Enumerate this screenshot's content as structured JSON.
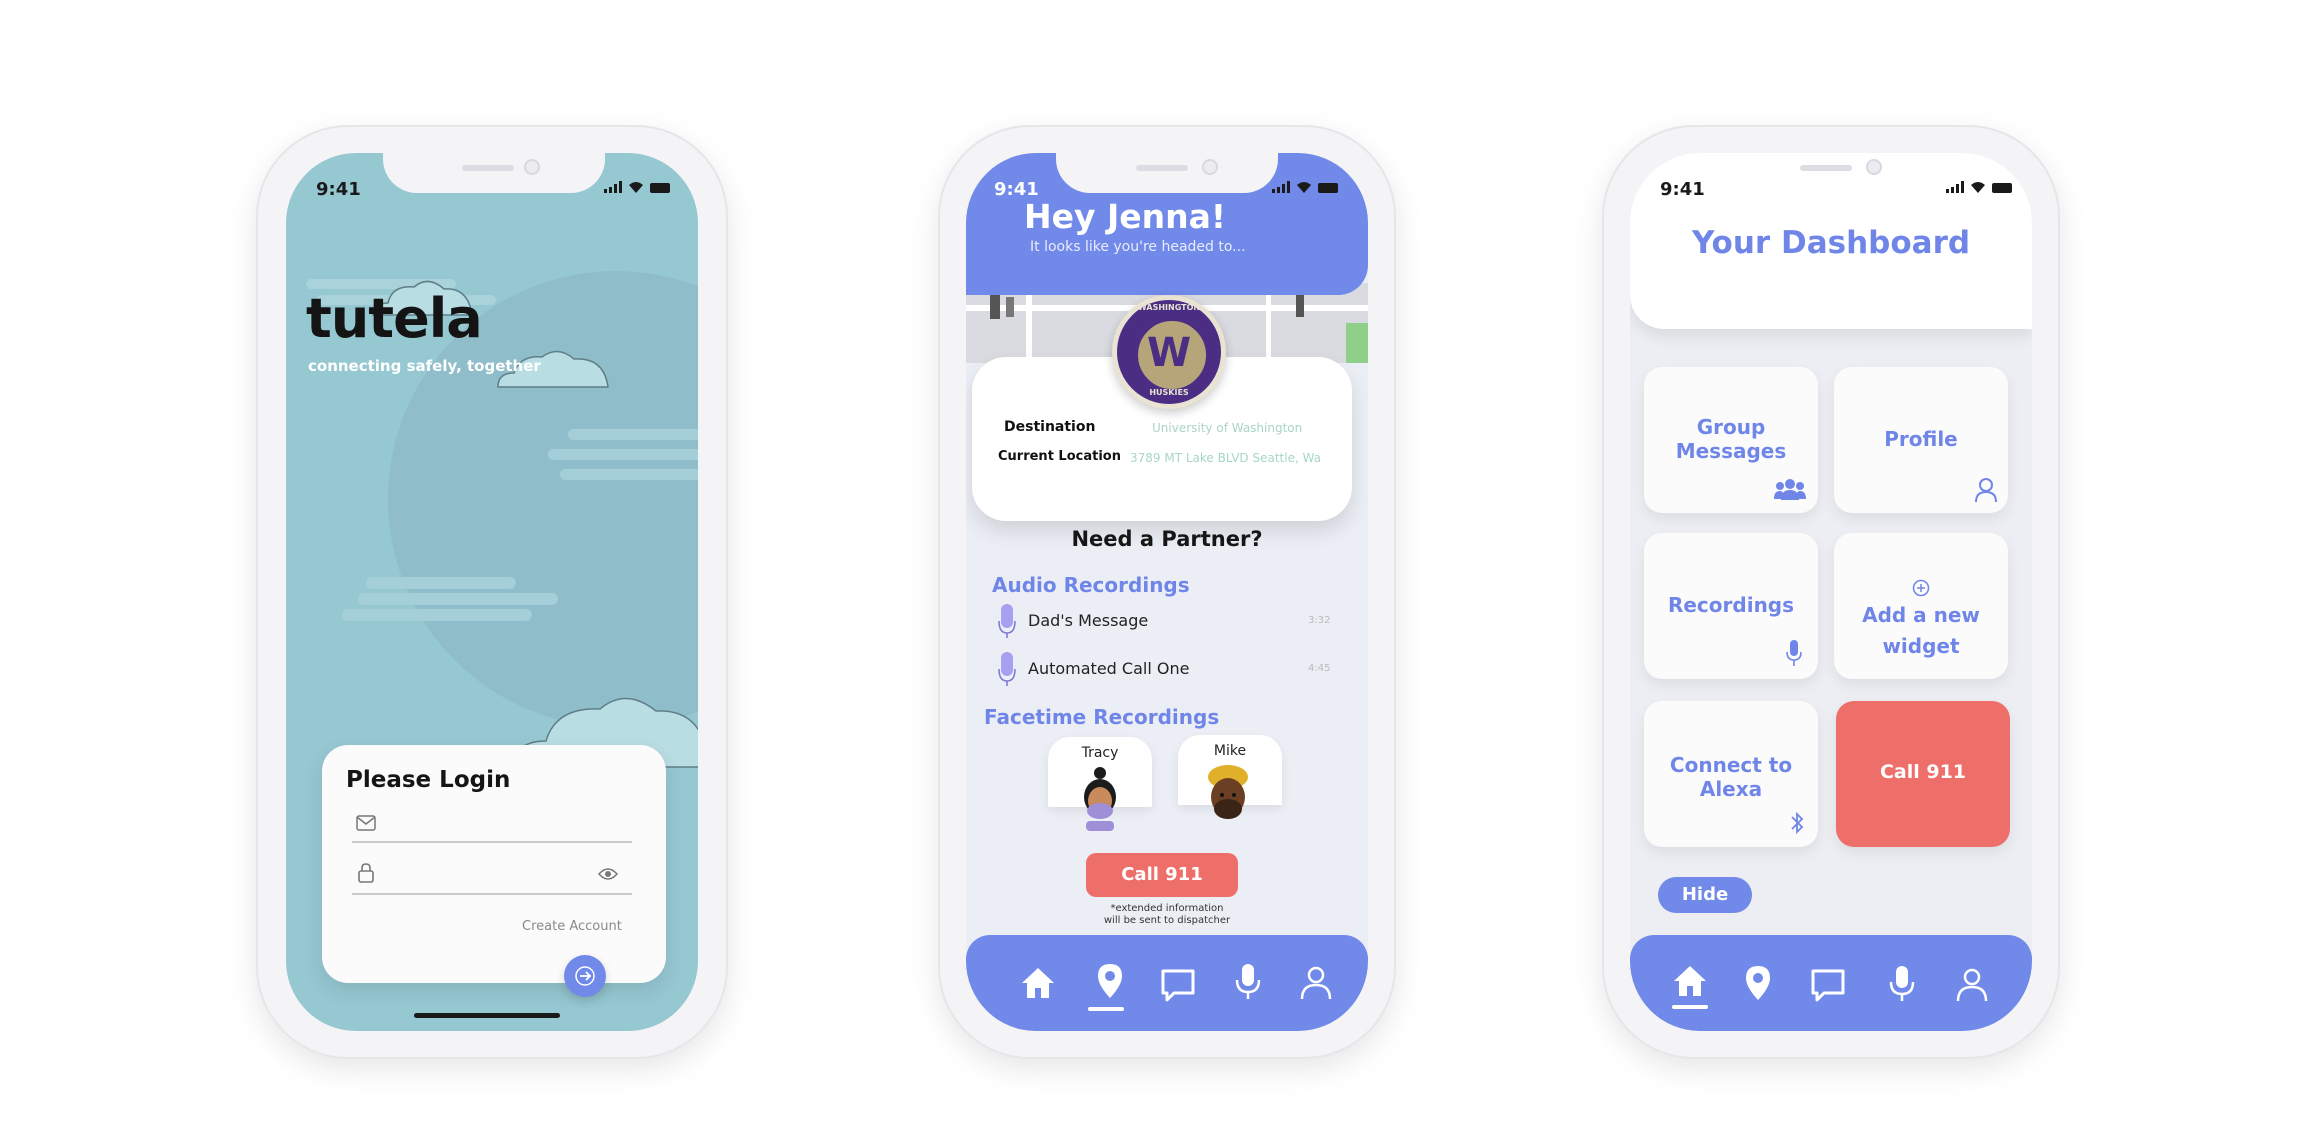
{
  "status_bar": {
    "time": "9:41"
  },
  "login_screen": {
    "app_name": "tutela",
    "tagline": "connecting safely, together",
    "card_title": "Please Login",
    "email_value": "",
    "password_value": "",
    "create_account": "Create Account",
    "icons": {
      "email": "envelope-icon",
      "password": "lock-icon",
      "show": "eye-icon",
      "submit": "arrow-right-icon"
    }
  },
  "location_screen": {
    "greeting": "Hey Jenna!",
    "subtitle": "It looks like you're headed to...",
    "badge": {
      "top_text": "WASHINGTON",
      "letter": "W",
      "bottom_text": "HUSKIES"
    },
    "destination_label": "Destination",
    "destination_value": "University of Washington",
    "current_location_label": "Current Location",
    "current_location_value": "3789 MT Lake BLVD  Seattle, Wa",
    "partner_prompt": "Need a Partner?",
    "audio_title": "Audio Recordings",
    "audio_recordings": [
      {
        "name": "Dad's Message",
        "duration": "3:32"
      },
      {
        "name": "Automated Call One",
        "duration": "4:45"
      }
    ],
    "facetime_title": "Facetime Recordings",
    "facetime_recordings": [
      {
        "name": "Tracy"
      },
      {
        "name": "Mike"
      }
    ],
    "call_button": "Call 911",
    "footnote_line1": "*extended information",
    "footnote_line2": "will be sent to dispatcher"
  },
  "dashboard_screen": {
    "title": "Your Dashboard",
    "tiles": {
      "group_messages_line1": "Group",
      "group_messages_line2": "Messages",
      "profile": "Profile",
      "recordings": "Recordings",
      "add_widget_line1": "Add a new",
      "add_widget_line2": "widget",
      "alexa_line1": "Connect to",
      "alexa_line2": "Alexa",
      "call": "Call 911"
    },
    "hide_button": "Hide"
  },
  "nav_items": [
    "home-icon",
    "location-pin-icon",
    "chat-icon",
    "microphone-icon",
    "person-icon"
  ],
  "colors": {
    "accent": "#7189e8",
    "accent_text": "#6f86e8",
    "login_background": "#96c8d2",
    "call_red": "#ee6f6a",
    "destination_text": "#a8d6c4"
  }
}
